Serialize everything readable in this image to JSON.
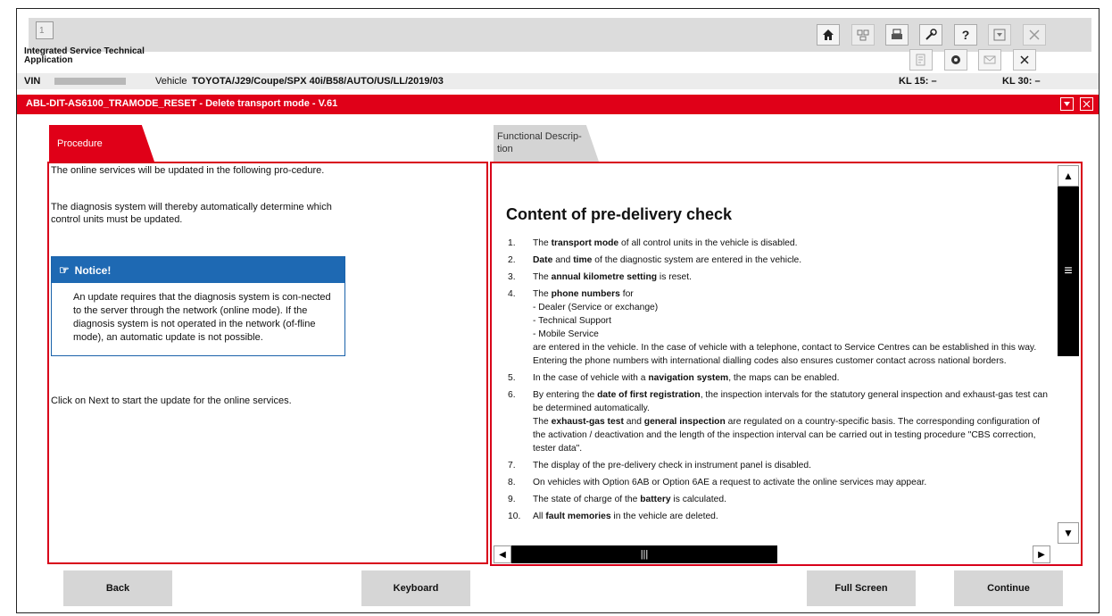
{
  "toolbar": {
    "tab_number": "1",
    "icons": [
      "home-icon",
      "device-icon",
      "printer-icon",
      "wrench-icon",
      "help-icon",
      "download-icon",
      "close-icon"
    ],
    "help_label": "?"
  },
  "app": {
    "title_line1": "Integrated Service Technical",
    "title_line2": "Application"
  },
  "vehicle_row": {
    "vin_label": "VIN",
    "vehicle_label": "Vehicle",
    "vehicle_value": "TOYOTA/J29/Coupe/SPX 40i/B58/AUTO/US/LL/2019/03",
    "kl15": "KL 15:  –",
    "kl30": "KL 30:  –"
  },
  "module_title": "ABL-DIT-AS6100_TRAMODE_RESET - Delete transport mode - V.61",
  "tabs": {
    "procedure": "Procedure",
    "functional": "Functional Descrip-tion"
  },
  "left": {
    "para1": "The online services will be updated in the following pro-cedure.",
    "para2": "The diagnosis system will thereby automatically determine which control units must be updated.",
    "notice_title": "Notice!",
    "notice_body": "An update requires that the diagnosis system is con-nected to the server through the network (online mode). If the diagnosis system is not operated in the network (of-fline mode), an automatic update is not possible.",
    "para3": "Click on Next to start the update for the online services."
  },
  "right": {
    "heading": "Content of pre-delivery check",
    "items": [
      {
        "n": "1.",
        "html": "The <b>transport mode</b> of all control units in the vehicle is disabled."
      },
      {
        "n": "2.",
        "html": "<b>Date</b> and <b>time</b> of the diagnostic system are entered in the vehicle."
      },
      {
        "n": "3.",
        "html": "The <b>annual kilometre setting</b> is reset."
      },
      {
        "n": "4.",
        "html": "The <b>phone numbers</b> for<br>- Dealer (Service or exchange)<br>- Technical Support<br>- Mobile Service<br>are entered in the vehicle. In the case of vehicle with a telephone, contact to Service Centres can be established in this way. Entering the phone numbers with international dialling codes also ensures customer contact across national borders."
      },
      {
        "n": "5.",
        "html": "In the case of vehicle with a <b>navigation system</b>, the maps can be enabled."
      },
      {
        "n": "6.",
        "html": "By entering the <b>date of first registration</b>, the inspection intervals for the statutory general inspection and exhaust-gas test can be determined automatically.<br>The <b>exhaust-gas test</b> and <b>general inspection</b> are regulated on a country-specific basis. The corresponding configuration of the activation / deactivation and the length of the inspection interval can be carried out in testing procedure \"CBS correction, tester data\"."
      },
      {
        "n": "7.",
        "html": "The display of the pre-delivery check in instrument panel is disabled."
      },
      {
        "n": "8.",
        "html": "On vehicles with Option 6AB or Option 6AE a request to activate the online services may appear."
      },
      {
        "n": "9.",
        "html": "The state of charge of the <b>battery</b> is calculated."
      },
      {
        "n": "10.",
        "html": "All <b>fault memories</b> in the vehicle are deleted."
      }
    ]
  },
  "buttons": {
    "back": "Back",
    "keyboard": "Keyboard",
    "full_screen": "Full Screen",
    "continue": "Continue"
  }
}
